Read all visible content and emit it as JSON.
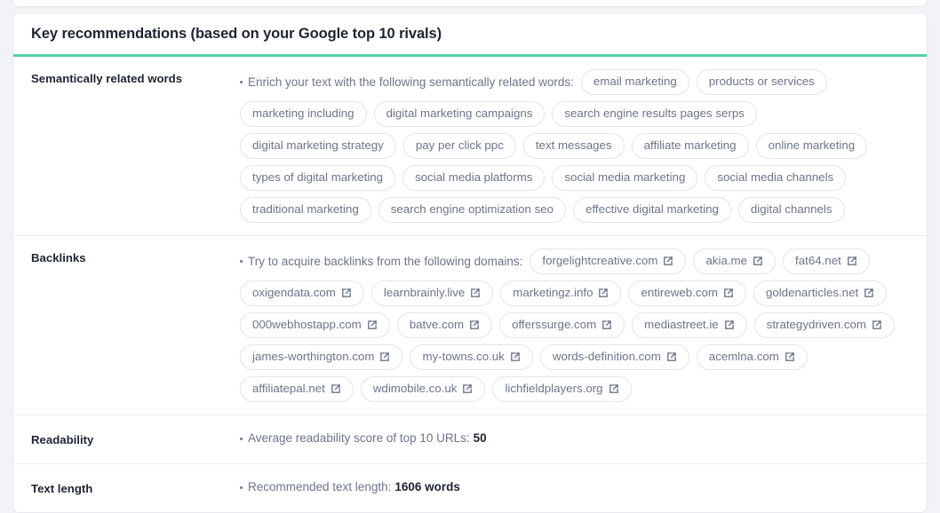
{
  "card": {
    "title": "Key recommendations (based on your Google top 10 rivals)",
    "accent_color": "#55d4a4",
    "border_color": "#e6e8ee",
    "background": "#ffffff"
  },
  "sections": {
    "semantic": {
      "label": "Semantically related words",
      "lead": "Enrich your text with the following semantically related words:",
      "tags": [
        "email marketing",
        "products or services",
        "marketing including",
        "digital marketing campaigns",
        "search engine results pages serps",
        "digital marketing strategy",
        "pay per click ppc",
        "text messages",
        "affiliate marketing",
        "online marketing",
        "types of digital marketing",
        "social media platforms",
        "social media marketing",
        "social media channels",
        "traditional marketing",
        "search engine optimization seo",
        "effective digital marketing",
        "digital channels"
      ]
    },
    "backlinks": {
      "label": "Backlinks",
      "lead": "Try to acquire backlinks from the following domains:",
      "icon": "external-link-icon",
      "domains": [
        "forgelightcreative.com",
        "akia.me",
        "fat64.net",
        "oxigendata.com",
        "learnbrainly.live",
        "marketingz.info",
        "entireweb.com",
        "goldenarticles.net",
        "000webhostapp.com",
        "batve.com",
        "offerssurge.com",
        "mediastreet.ie",
        "strategydriven.com",
        "james-worthington.com",
        "my-towns.co.uk",
        "words-definition.com",
        "acemlna.com",
        "affiliatepal.net",
        "wdimobile.co.uk",
        "lichfieldplayers.org"
      ]
    },
    "readability": {
      "label": "Readability",
      "text": "Average readability score of top 10 URLs:",
      "value": "50"
    },
    "text_length": {
      "label": "Text length",
      "text": "Recommended text length:",
      "value": "1606 words"
    }
  }
}
